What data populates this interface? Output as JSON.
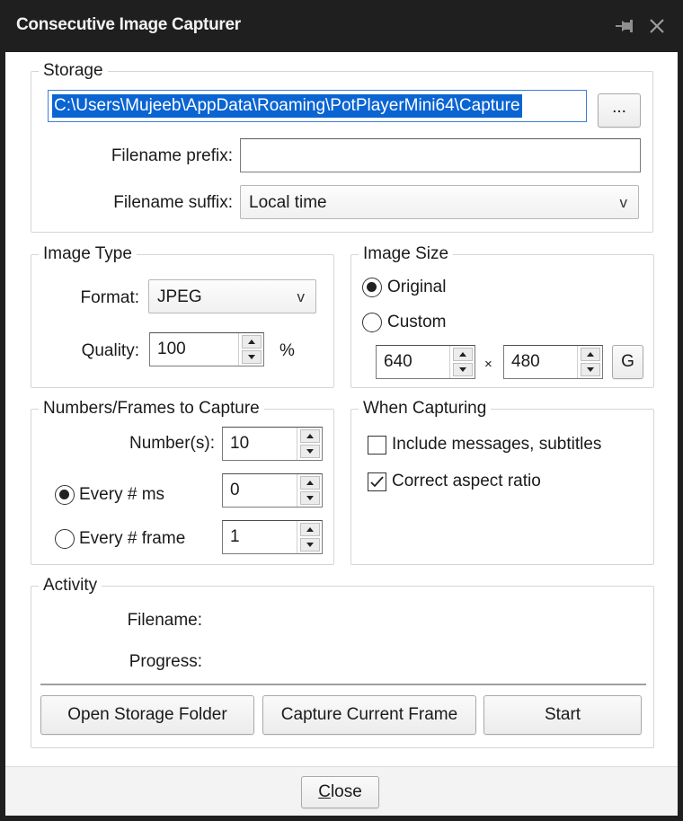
{
  "window": {
    "title": "Consecutive Image Capturer",
    "icons": {
      "pin": "pin-icon",
      "close": "close-icon"
    }
  },
  "storage": {
    "legend": "Storage",
    "path_value": "C:\\Users\\Mujeeb\\AppData\\Roaming\\PotPlayerMini64\\Capture",
    "browse_label": "...",
    "prefix_label": "Filename prefix:",
    "prefix_value": "",
    "suffix_label": "Filename suffix:",
    "suffix_value": "Local time"
  },
  "image_type": {
    "legend": "Image Type",
    "format_label": "Format:",
    "format_value": "JPEG",
    "quality_label": "Quality:",
    "quality_value": "100",
    "quality_unit": "%"
  },
  "image_size": {
    "legend": "Image Size",
    "original_label": "Original",
    "original_selected": true,
    "custom_label": "Custom",
    "custom_selected": false,
    "width_value": "640",
    "times": "×",
    "height_value": "480",
    "g_label": "G"
  },
  "frames": {
    "legend": "Numbers/Frames to Capture",
    "number_label": "Number(s):",
    "number_value": "10",
    "every_ms_label": "Every # ms",
    "every_ms_selected": true,
    "every_ms_value": "0",
    "every_frame_label": "Every # frame",
    "every_frame_selected": false,
    "every_frame_value": "1"
  },
  "when_capturing": {
    "legend": "When Capturing",
    "include_messages_label": "Include messages, subtitles",
    "include_messages_checked": false,
    "correct_aspect_label": "Correct aspect ratio",
    "correct_aspect_checked": true
  },
  "activity": {
    "legend": "Activity",
    "filename_label": "Filename:",
    "filename_value": "",
    "progress_label": "Progress:",
    "progress_value": "",
    "open_folder_label": "Open Storage Folder",
    "capture_frame_label": "Capture Current Frame",
    "start_label": "Start"
  },
  "footer": {
    "close_label_mnemonic": "C",
    "close_label_rest": "lose"
  }
}
